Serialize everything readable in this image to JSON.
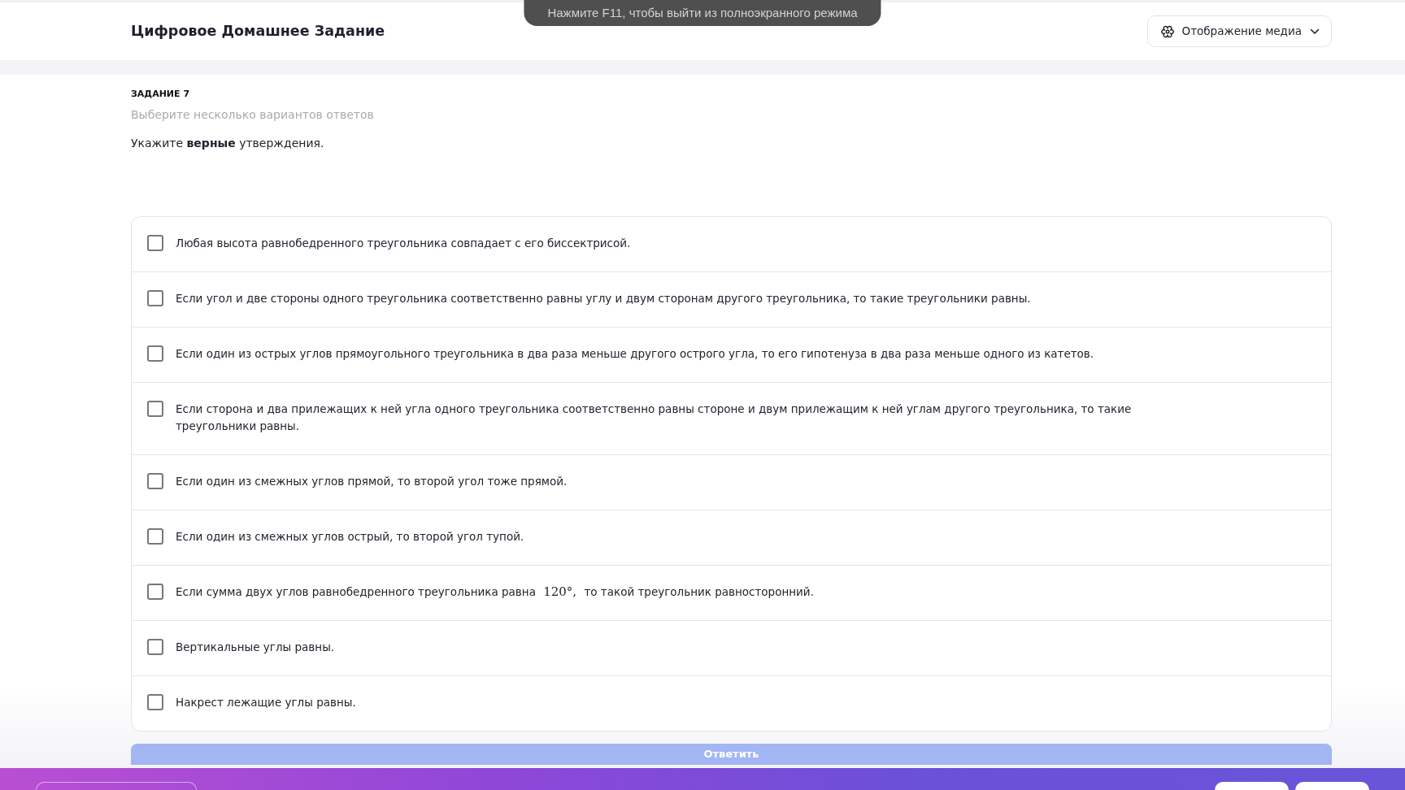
{
  "header": {
    "title": "Цифровое Домашнее Задание",
    "media_button": {
      "label": "Отображение медиа"
    }
  },
  "fullscreen_toast": {
    "text": "Нажмите F11, чтобы выйти из полноэкранного режима"
  },
  "task": {
    "number_label": "ЗАДАНИЕ 7",
    "hint": "Выберите несколько вариантов ответов",
    "prompt": "Укажите **верные** утверждения."
  },
  "options": [
    {
      "text": "Любая высота равнобедренного треугольника совпадает с его биссектрисой.",
      "checked": false
    },
    {
      "text": "Если угол и две стороны одного треугольника соответственно равны углу и двум сторонам другого треугольника, то такие треугольники равны.",
      "checked": false
    },
    {
      "text": "Если один из острых углов прямоугольного треугольника в два раза меньше другого острого угла, то его гипотенуза в два раза меньше одного из катетов.",
      "checked": false
    },
    {
      "text": "Если сторона и два прилежащих к ней угла одного треугольника соответственно равны стороне и двум прилежащим к ней углам другого треугольника, то такие треугольники равны.",
      "checked": false
    },
    {
      "text": "Если один из смежных углов прямой, то второй угол тоже прямой.",
      "checked": false
    },
    {
      "text": "Если один из смежных углов острый, то второй угол тупой.",
      "checked": false
    },
    {
      "parts": [
        {
          "kind": "text",
          "text": "Если сумма двух углов равнобедренного треугольника равна"
        },
        {
          "kind": "math",
          "text": "120°,"
        },
        {
          "kind": "text",
          "text": "то такой треугольник равносторонний."
        }
      ],
      "checked": false
    },
    {
      "text": "Вертикальные углы равны.",
      "checked": false
    },
    {
      "text": "Накрест лежащие углы равны.",
      "checked": false
    }
  ],
  "submit_button": {
    "label": "Ответить",
    "disabled": true
  },
  "bottom_bar": {
    "buttons": [
      {
        "kind": "outline"
      },
      {
        "kind": "solid"
      },
      {
        "kind": "solid"
      }
    ]
  }
}
